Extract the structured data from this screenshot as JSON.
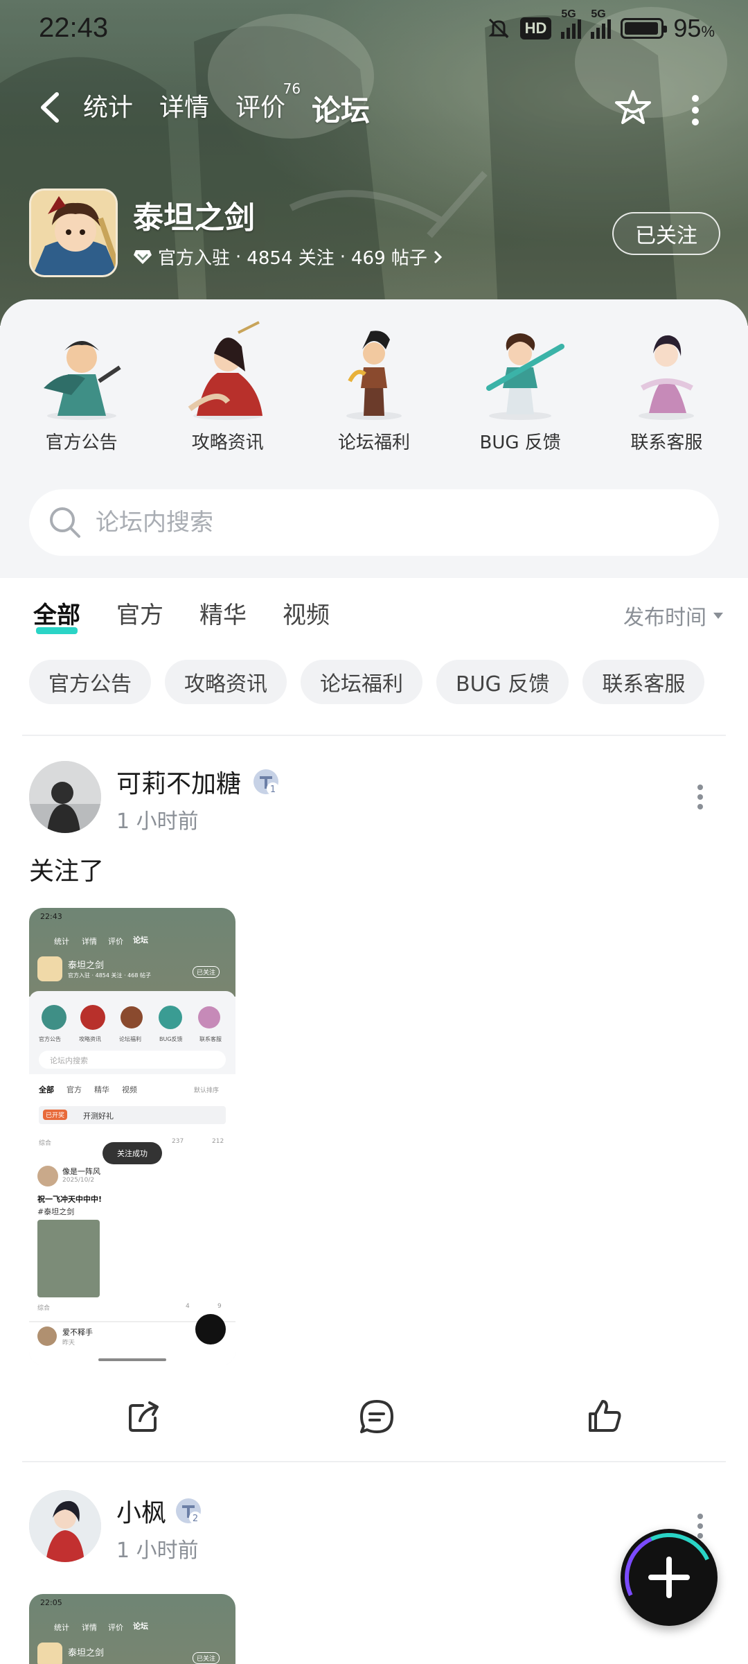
{
  "status_bar": {
    "time": "22:43",
    "hd_label": "HD",
    "net_1": "5G",
    "net_2": "5G",
    "battery_percent": 95,
    "battery_label": "95"
  },
  "nav": {
    "tabs": [
      {
        "label": "统计"
      },
      {
        "label": "详情"
      },
      {
        "label": "评价",
        "badge": "76"
      },
      {
        "label": "论坛",
        "active": true
      }
    ]
  },
  "game": {
    "name": "泰坦之剑",
    "official_label": "官方入驻",
    "followers": "4854 关注",
    "posts": "469 帖子",
    "follow_button": "已关注"
  },
  "categories": [
    {
      "label": "官方公告",
      "color": "#3f8f86"
    },
    {
      "label": "攻略资讯",
      "color": "#b8302b"
    },
    {
      "label": "论坛福利",
      "color": "#8a4a2e"
    },
    {
      "label": "BUG 反馈",
      "color": "#3a9c93"
    },
    {
      "label": "联系客服",
      "color": "#c68ab8"
    }
  ],
  "search": {
    "placeholder": "论坛内搜索"
  },
  "filters": {
    "tabs": [
      {
        "label": "全部",
        "active": true
      },
      {
        "label": "官方"
      },
      {
        "label": "精华"
      },
      {
        "label": "视频"
      }
    ],
    "sort_label": "发布时间",
    "chips": [
      "官方公告",
      "攻略资讯",
      "论坛福利",
      "BUG 反馈",
      "联系客服"
    ]
  },
  "posts": [
    {
      "author": "可莉不加糖",
      "level": "1",
      "time": "1 小时前",
      "text": "关注了",
      "thumb": {
        "time": "22:43",
        "tabs": [
          "统计",
          "详情",
          "评价",
          "论坛"
        ],
        "game": "泰坦之剑",
        "meta": "官方入驻 · 4854 关注 · 468 帖子",
        "follow": "已关注",
        "cats": [
          "官方公告",
          "攻略资讯",
          "论坛福利",
          "BUG反馈",
          "联系客服"
        ],
        "search": "论坛内搜索",
        "ftabs": [
          "全部",
          "官方",
          "精华",
          "视频"
        ],
        "sort": "默认排序",
        "pinned_tag": "已开奖",
        "pinned_title": "开测好礼",
        "row_label": "综合",
        "comments": "237",
        "likes": "212",
        "toast": "关注成功",
        "post1_author": "像是一阵风",
        "post1_date": "2025/10/2",
        "post1_text": "祝一飞冲天中中中!",
        "post1_tag": "#泰坦之剑",
        "row2_label": "综合",
        "row2_comments": "4",
        "row2_likes": "9",
        "post2_author": "爱不释手",
        "post2_date": "昨天"
      }
    },
    {
      "author": "小枫",
      "level": "2",
      "time": "1 小时前",
      "thumb": {
        "time": "22:05",
        "tabs": [
          "统计",
          "详情",
          "评价",
          "论坛"
        ],
        "game": "泰坦之剑",
        "follow": "已关注"
      }
    }
  ],
  "colors": {
    "accent": "#2ad4c6",
    "sheet": "#f4f5f7",
    "banner": "#6f8574"
  },
  "icons": {
    "back": "back-icon",
    "star": "star-icon",
    "more": "more-icon",
    "search": "search-icon",
    "share": "share-icon",
    "comment": "comment-icon",
    "like": "like-icon",
    "plus": "plus-icon"
  }
}
